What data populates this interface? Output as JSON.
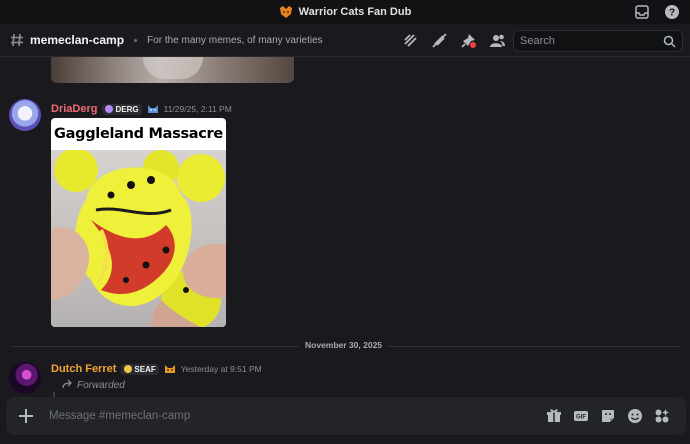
{
  "window": {
    "title": "Warrior Cats Fan Dub"
  },
  "channel": {
    "name": "memeclan-camp",
    "topic": "For the many memes, of many varieties"
  },
  "search": {
    "placeholder": "Search"
  },
  "messages": [
    {
      "author": "DriaDerg",
      "author_color": "#f06a78",
      "tag": "DERG",
      "timestamp": "11/29/25, 2:11 PM",
      "embed_title": "Gaggleland Massacre"
    },
    {
      "author": "Dutch Ferret",
      "author_color": "#f0a235",
      "tag": "SEAF",
      "timestamp": "Yesterday at 9:51 PM",
      "forwarded_label": "Forwarded"
    }
  ],
  "date_divider": "November 30, 2025",
  "composer": {
    "placeholder": "Message #memeclan-camp"
  },
  "colors": {
    "background": "#1a1a1e",
    "accent_red": "#f23f43",
    "composer_bg": "#232428"
  }
}
